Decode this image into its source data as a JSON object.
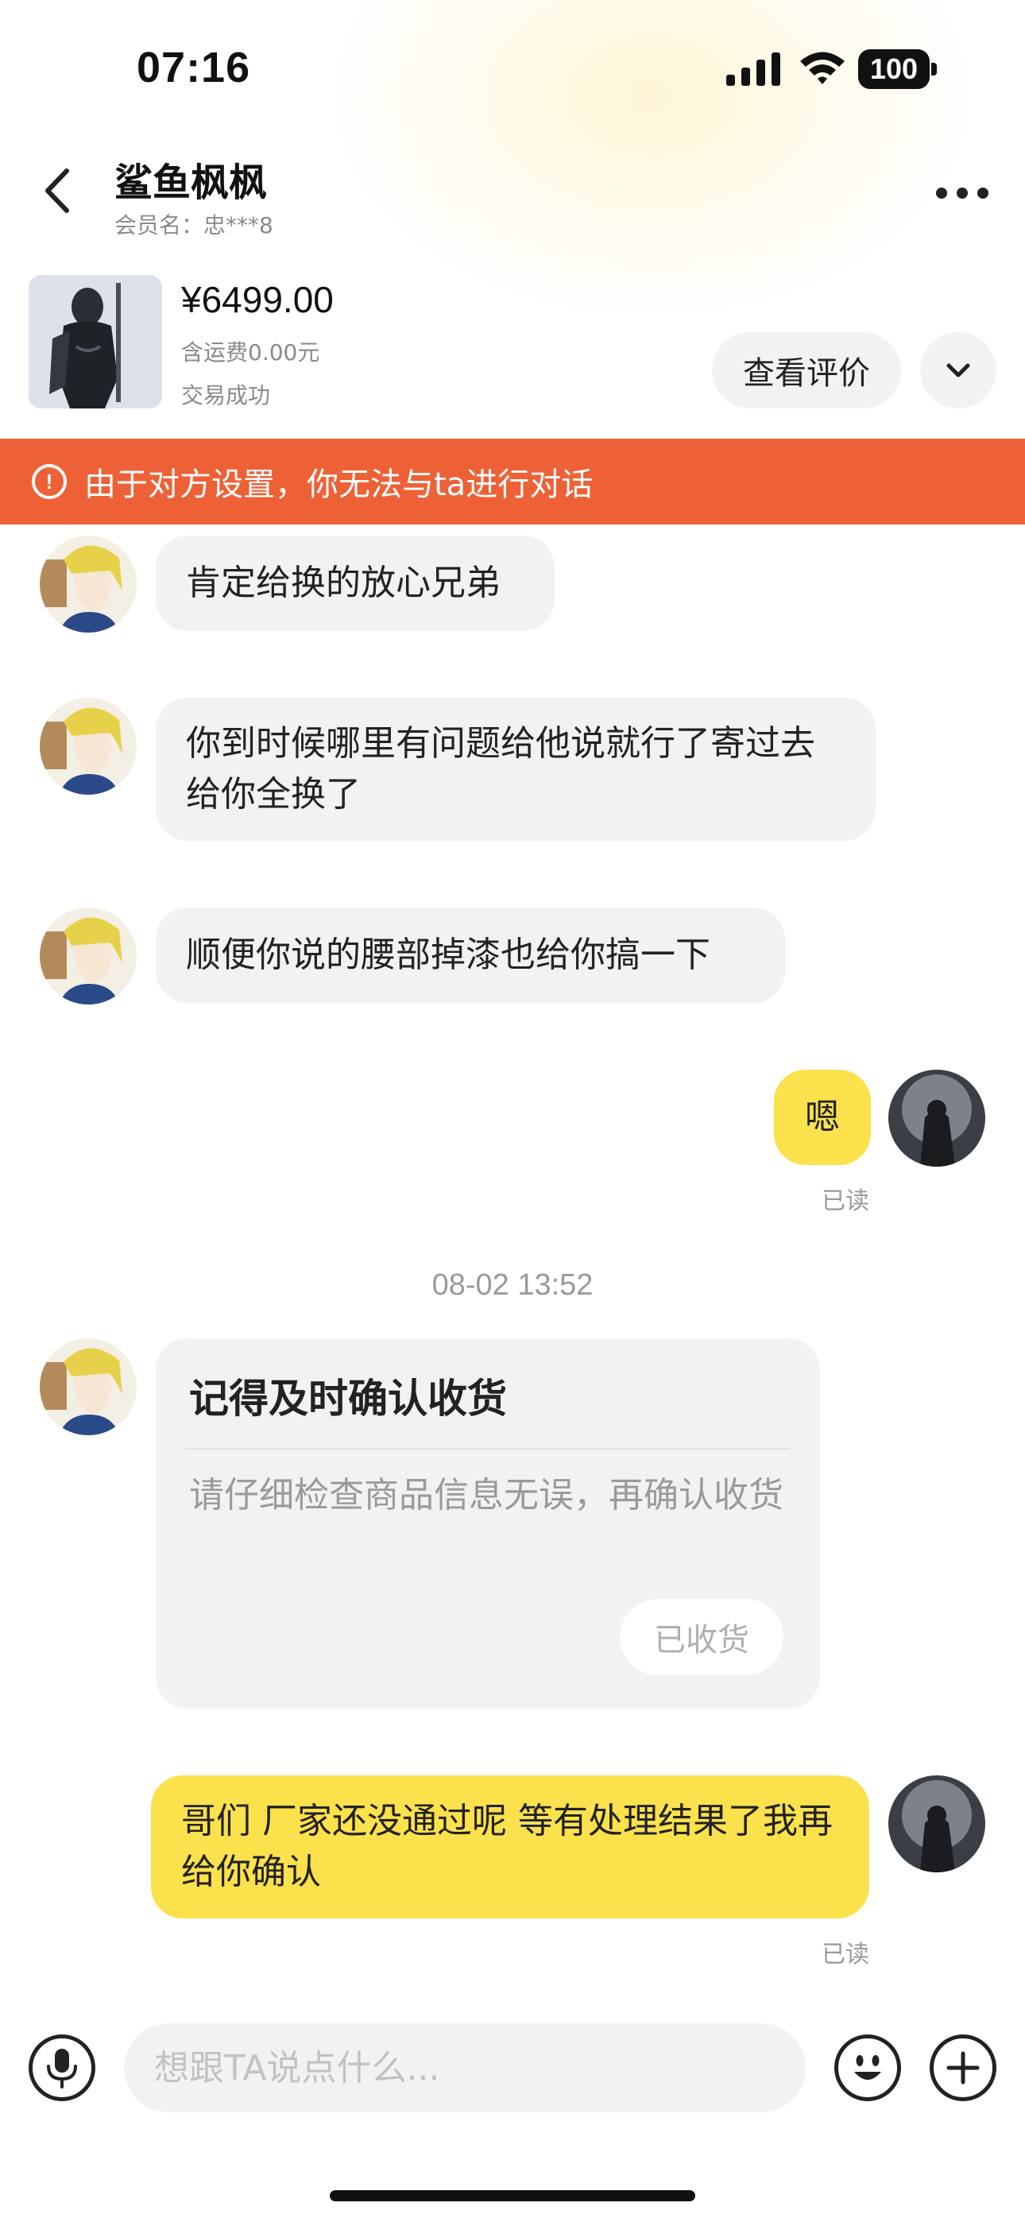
{
  "status_bar": {
    "time": "07:16",
    "battery": "100",
    "icons": [
      "signal-icon",
      "wifi-icon",
      "battery-icon"
    ]
  },
  "header": {
    "title": "鲨鱼枫枫",
    "subtitle": "会员名：忠***8",
    "icons": [
      "back-arrow-icon",
      "more-icon"
    ]
  },
  "product": {
    "price": "¥6499.00",
    "shipping": "含运费0.00元",
    "status": "交易成功",
    "view_review_label": "查看评价",
    "expand_icon": "chevron-down-icon"
  },
  "banner": {
    "icon": "exclamation-circle-icon",
    "text": "由于对方设置，你无法与ta进行对话",
    "color": "#ee6137"
  },
  "messages": [
    {
      "side": "left",
      "text": "肯定给换的放心兄弟"
    },
    {
      "side": "left",
      "text": "你到时候哪里有问题给他说就行了寄过去给你全换了"
    },
    {
      "side": "left",
      "text": "顺便你说的腰部掉漆也给你搞一下"
    },
    {
      "side": "right",
      "text": "嗯",
      "read": "已读"
    }
  ],
  "timestamp": "08-02 13:52",
  "confirm_card": {
    "title": "记得及时确认收货",
    "description": "请仔细检查商品信息无误，再确认收货",
    "button_label": "已收货"
  },
  "last_message": {
    "side": "right",
    "text": "哥们 厂家还没通过呢 等有处理结果了我再给你确认",
    "read": "已读"
  },
  "input_bar": {
    "placeholder": "想跟TA说点什么...",
    "icons": [
      "microphone-icon",
      "emoji-icon",
      "plus-icon"
    ]
  },
  "colors": {
    "outgoing_bubble": "#fbe14c",
    "incoming_bubble": "#f2f2f4",
    "banner": "#ee6137"
  }
}
